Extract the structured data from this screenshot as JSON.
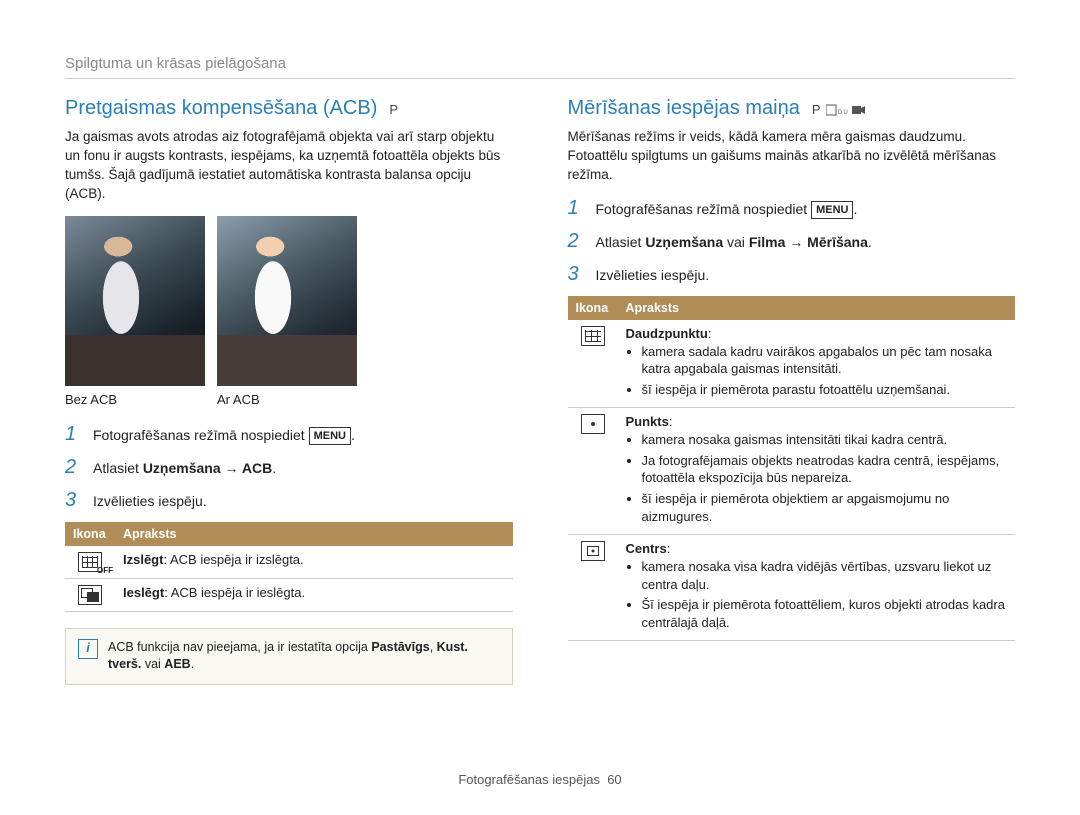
{
  "breadcrumb": "Spilgtuma un krāsas pielāgošana",
  "left": {
    "title": "Pretgaismas kompensēšana (ACB)",
    "title_mode": "P",
    "intro": "Ja gaismas avots atrodas aiz fotografējamā objekta vai arī starp objektu un fonu ir augsts kontrasts, iespējams, ka uzņemtā fotoattēla objekts būs tumšs. Šajā gadījumā iestatiet automātiska kontrasta balansa opciju (ACB).",
    "cap_off": "Bez ACB",
    "cap_on": "Ar ACB",
    "step1_a": "Fotografēšanas režīmā nospiediet ",
    "menu_label": "MENU",
    "step2_a": "Atlasiet ",
    "step2_b": "Uzņemšana → ACB",
    "step3": "Izvēlieties iespēju.",
    "th_icon": "Ikona",
    "th_desc": "Apraksts",
    "row_off_b": "Izslēgt",
    "row_off_t": ": ACB iespēja ir izslēgta.",
    "row_on_b": "Ieslēgt",
    "row_on_t": ": ACB iespēja ir ieslēgta.",
    "note_a": "ACB funkcija nav pieejama, ja ir iestatīta opcija ",
    "note_b": "Pastāvīgs",
    "note_c": ", ",
    "note_d": "Kust. tverš.",
    "note_e": " vai ",
    "note_f": "AEB",
    "note_g": "."
  },
  "right": {
    "title": "Mērīšanas iespējas maiņa",
    "intro": "Mērīšanas režīms ir veids, kādā kamera mēra gaismas daudzumu. Fotoattēlu spilgtums un gaišums mainās atkarībā no izvēlētā mērīšanas režīma.",
    "step1_a": "Fotografēšanas režīmā nospiediet ",
    "step2_a": "Atlasiet ",
    "step2_b1": "Uzņemšana",
    "step2_c": " vai ",
    "step2_b2": "Filma",
    "step2_d": " → ",
    "step2_b3": "Mērīšana",
    "step3": "Izvēlieties iespēju.",
    "th_icon": "Ikona",
    "th_desc": "Apraksts",
    "r1_h": "Daudzpunktu",
    "r1_l1": "kamera sadala kadru vairākos apgabalos un pēc tam nosaka katra apgabala gaismas intensitāti.",
    "r1_l2": "šī iespēja ir piemērota parastu fotoattēlu uzņemšanai.",
    "r2_h": "Punkts",
    "r2_l1": "kamera nosaka gaismas intensitāti tikai kadra centrā.",
    "r2_l2": "Ja fotografējamais objekts neatrodas kadra centrā, iespējams, fotoattēla ekspozīcija būs nepareiza.",
    "r2_l3": "šī iespēja ir piemērota objektiem ar apgaismojumu no aizmugures.",
    "r3_h": "Centrs",
    "r3_l1": "kamera nosaka visa kadra vidējās vērtības, uzsvaru liekot uz centra daļu.",
    "r3_l2": "Šī iespēja ir piemērota fotoattēliem, kuros objekti atrodas kadra centrālajā daļā."
  },
  "footer_a": "Fotografēšanas iespējas",
  "footer_pg": "60"
}
